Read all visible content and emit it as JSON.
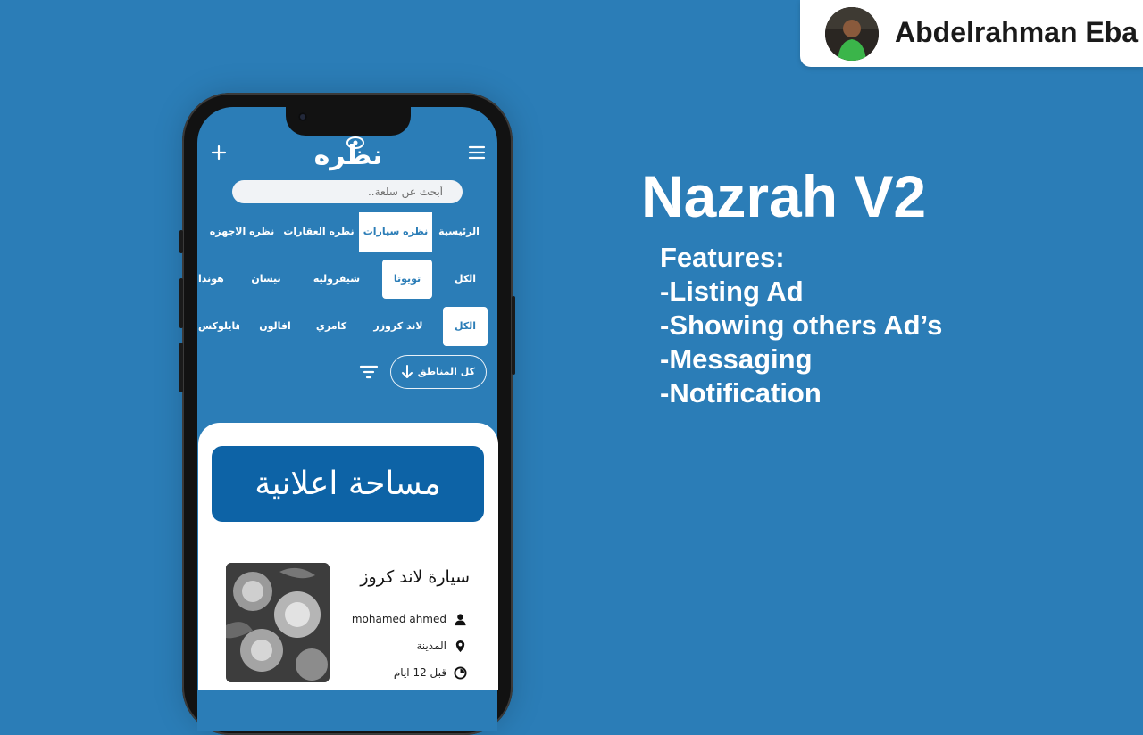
{
  "author": {
    "name": "Abdelrahman Eba"
  },
  "title": "Nazrah V2",
  "features": {
    "heading": "Features:",
    "items": [
      "-Listing Ad",
      "-Showing others Ad’s",
      "-Messaging",
      "-Notification"
    ]
  },
  "app": {
    "logo_text": "نظره",
    "search_placeholder": "أبحث عن سلعة..",
    "main_tabs": [
      "الرئيسية",
      "نظره سيارات",
      "نظره العقارات",
      "نظره الاجهزه"
    ],
    "active_tab": "نظره سيارات",
    "brand_chips": [
      "الكل",
      "تويوتا",
      "شيفروليه",
      "نيسان",
      "هوندا"
    ],
    "active_brand": "تويوتا",
    "model_chips": [
      "الكل",
      "لاند كروزر",
      "كامري",
      "افالون",
      "هايلوكس"
    ],
    "active_model": "الكل",
    "region_button": "كل المناطق",
    "ad_banner_text": "مساحة اعلانية",
    "listing": {
      "title": "سيارة لاند كروز",
      "user": "mohamed ahmed",
      "city": "المدينة",
      "time": "قبل 12 ايام"
    },
    "icons": [
      "menu-icon",
      "plus-icon",
      "arrow-down-icon",
      "filter-icon",
      "user-icon",
      "location-pin-icon",
      "clock-icon"
    ]
  },
  "colors": {
    "background": "#2b7db7",
    "accent": "#0d63a6",
    "white": "#ffffff"
  }
}
